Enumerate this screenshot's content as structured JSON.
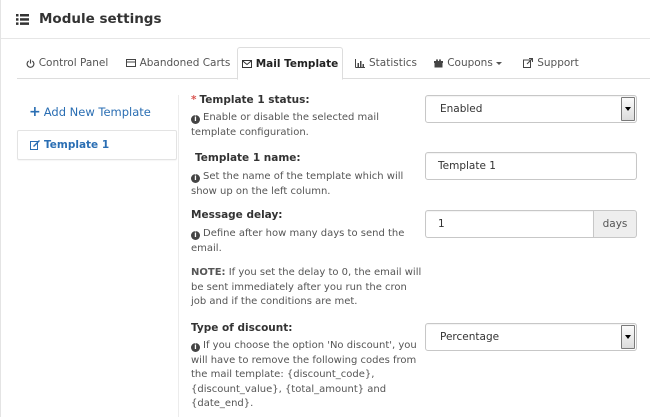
{
  "header": {
    "title": "Module settings",
    "icon": "list-icon"
  },
  "tabs": [
    {
      "label": "Control Panel",
      "icon": "power-icon"
    },
    {
      "label": "Abandoned Carts",
      "icon": "cart-icon"
    },
    {
      "label": "Mail Template",
      "icon": "envelope-icon",
      "active": true
    },
    {
      "label": "Statistics",
      "icon": "bar-chart-icon"
    },
    {
      "label": "Coupons",
      "icon": "gift-icon",
      "dropdown": true
    },
    {
      "label": "Support",
      "icon": "external-link-icon"
    }
  ],
  "sidebar": {
    "add_label": "Add New Template",
    "templates": [
      {
        "label": "Template 1",
        "icon": "edit-icon"
      }
    ]
  },
  "form": {
    "status": {
      "required": "*",
      "label": "Template 1 status:",
      "help1": "Enable or disable the selected mail",
      "help2": "template configuration.",
      "value": "Enabled"
    },
    "name": {
      "label": "Template 1 name:",
      "help1": "Set the name of the template which will",
      "help2": "show up on the left column.",
      "value": "Template 1"
    },
    "delay": {
      "label": "Message delay:",
      "help1": "Define after how many days to send the",
      "help2": "email.",
      "note_bold": "NOTE:",
      "note1": " If you set the delay to 0, the email will",
      "note2": "be sent immediately after you run the cron",
      "note3": "job and if the conditions are met.",
      "value": "1",
      "unit": "days"
    },
    "discount": {
      "label": "Type of discount:",
      "help1": "If you choose the option 'No discount', you",
      "help2": "will have to remove the following codes from",
      "help3": "the mail template: {discount_code},",
      "help4": "{discount_value}, {total_amount} and",
      "help5": "{date_end}.",
      "value": "Percentage"
    }
  },
  "colors": {
    "link": "#2a6eb3",
    "required": "#d9534f",
    "border": "#c7c7c7"
  }
}
